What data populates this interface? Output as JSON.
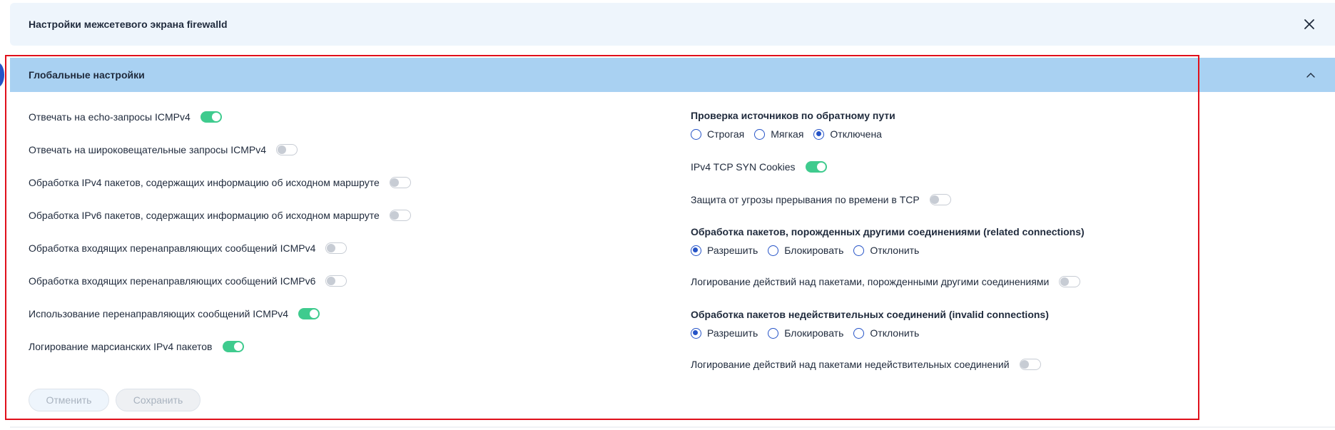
{
  "dialog": {
    "title": "Настройки межсетевого экрана firewalld",
    "close_icon": "close-icon"
  },
  "section": {
    "title": "Глобальные настройки",
    "collapse_icon": "chevron-up-icon"
  },
  "left_toggles": [
    {
      "label": "Отвечать на echo-запросы ICMPv4",
      "on": true
    },
    {
      "label": "Отвечать на широковещательные запросы ICMPv4",
      "on": false
    },
    {
      "label": "Обработка IPv4 пакетов, содержащих информацию об исходном маршруте",
      "on": false
    },
    {
      "label": "Обработка IPv6 пакетов, содержащих информацию об исходном маршруте",
      "on": false
    },
    {
      "label": "Обработка входящих перенаправляющих сообщений ICMPv4",
      "on": false
    },
    {
      "label": "Обработка входящих перенаправляющих сообщений ICMPv6",
      "on": false
    },
    {
      "label": "Использование перенаправляющих сообщений ICMPv4",
      "on": true
    },
    {
      "label": "Логирование марсианских IPv4 пакетов",
      "on": true
    }
  ],
  "right": {
    "rp_filter": {
      "title": "Проверка источников по обратному пути",
      "options": [
        "Строгая",
        "Мягкая",
        "Отключена"
      ],
      "selected": 2
    },
    "syn_cookies": {
      "label": "IPv4 TCP SYN Cookies",
      "on": true
    },
    "tcp_rfc1337": {
      "label": "Защита от угрозы прерывания по времени в TCP",
      "on": false
    },
    "related": {
      "title": "Обработка пакетов, порожденных другими соединениями (related connections)",
      "options": [
        "Разрешить",
        "Блокировать",
        "Отклонить"
      ],
      "selected": 0
    },
    "related_log": {
      "label": "Логирование действий над пакетами, порожденными другими соединениями",
      "on": false
    },
    "invalid": {
      "title": "Обработка пакетов недействительных соединений (invalid connections)",
      "options": [
        "Разрешить",
        "Блокировать",
        "Отклонить"
      ],
      "selected": 0
    },
    "invalid_log": {
      "label": "Логирование действий над пакетами недействительных соединений",
      "on": false
    }
  },
  "buttons": {
    "cancel": "Отменить",
    "save": "Сохранить"
  },
  "colors": {
    "toggle_on": "#3fcb8e",
    "radio": "#2553c7",
    "section_bg": "#a9d1f2",
    "highlight": "#e0101b"
  }
}
